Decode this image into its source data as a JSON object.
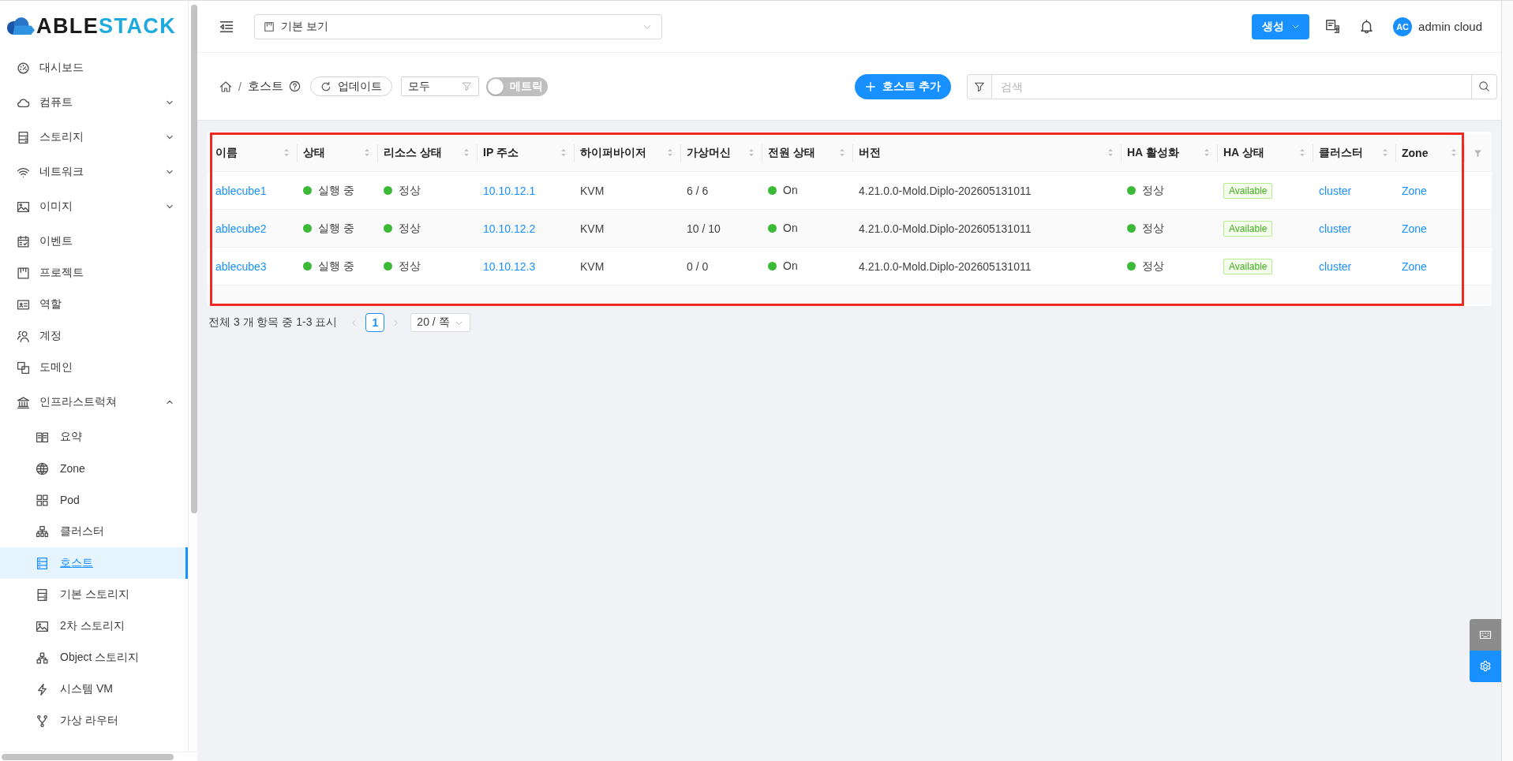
{
  "sidebar": {
    "logo": {
      "text": "ABLE",
      "accent_text": "STACK"
    },
    "items": [
      {
        "label": "대시보드",
        "kind": "item",
        "selected": false
      },
      {
        "label": "컴퓨트",
        "kind": "submenu",
        "expanded": false,
        "selected": false
      },
      {
        "label": "스토리지",
        "kind": "submenu",
        "expanded": false,
        "selected": false
      },
      {
        "label": "네트워크",
        "kind": "submenu",
        "expanded": false,
        "selected": false
      },
      {
        "label": "이미지",
        "kind": "submenu",
        "expanded": false,
        "selected": false
      },
      {
        "label": "이벤트",
        "kind": "item",
        "selected": false
      },
      {
        "label": "프로젝트",
        "kind": "item",
        "selected": false
      },
      {
        "label": "역할",
        "kind": "item",
        "selected": false
      },
      {
        "label": "계정",
        "kind": "item",
        "selected": false
      },
      {
        "label": "도메인",
        "kind": "item",
        "selected": false
      },
      {
        "label": "인프라스트럭쳐",
        "kind": "submenu",
        "expanded": true,
        "selected": false,
        "children": [
          {
            "label": "요약",
            "selected": false
          },
          {
            "label": "Zone",
            "selected": false
          },
          {
            "label": "Pod",
            "selected": false
          },
          {
            "label": "클러스터",
            "selected": false
          },
          {
            "label": "호스트",
            "selected": true
          },
          {
            "label": "기본 스토리지",
            "selected": false
          },
          {
            "label": "2차 스토리지",
            "selected": false
          },
          {
            "label": "Object 스토리지",
            "selected": false
          },
          {
            "label": "시스템 VM",
            "selected": false
          },
          {
            "label": "가상 라우터",
            "selected": false
          }
        ]
      }
    ]
  },
  "header": {
    "view_select": {
      "value": "기본 보기"
    },
    "create_button": {
      "label": "생성"
    },
    "user": {
      "initials": "AC",
      "name": "admin cloud"
    }
  },
  "toolbar": {
    "breadcrumb": {
      "separator": "/",
      "items": [
        "호스트"
      ]
    },
    "refresh_button": {
      "label": "업데이트"
    },
    "filter_select": {
      "value": "모두"
    },
    "metrics_toggle": {
      "label": "메트릭",
      "on": false
    },
    "add_button": {
      "label": "호스트 추가"
    },
    "search": {
      "placeholder": "검색"
    }
  },
  "table": {
    "highlighted": true,
    "columns": [
      {
        "label": "이름",
        "kind": "link"
      },
      {
        "label": "상태",
        "kind": "status"
      },
      {
        "label": "리소스 상태",
        "kind": "status"
      },
      {
        "label": "IP 주소",
        "kind": "link"
      },
      {
        "label": "하이퍼바이저",
        "kind": "text"
      },
      {
        "label": "가상머신",
        "kind": "text"
      },
      {
        "label": "전원 상태",
        "kind": "status"
      },
      {
        "label": "버전",
        "kind": "text"
      },
      {
        "label": "HA 활성화",
        "kind": "status"
      },
      {
        "label": "HA 상태",
        "kind": "tag"
      },
      {
        "label": "클러스터",
        "kind": "link"
      },
      {
        "label": "Zone",
        "kind": "link"
      }
    ],
    "rows": [
      {
        "cells": [
          "ablecube1",
          "실행 중",
          "정상",
          "10.10.12.1",
          "KVM",
          "6 / 6",
          "On",
          "4.21.0.0-Mold.Diplo-202605131011",
          "정상",
          "Available",
          "cluster",
          "Zone"
        ]
      },
      {
        "cells": [
          "ablecube2",
          "실행 중",
          "정상",
          "10.10.12.2",
          "KVM",
          "10 / 10",
          "On",
          "4.21.0.0-Mold.Diplo-202605131011",
          "정상",
          "Available",
          "cluster",
          "Zone"
        ]
      },
      {
        "cells": [
          "ablecube3",
          "실행 중",
          "정상",
          "10.10.12.3",
          "KVM",
          "0 / 0",
          "On",
          "4.21.0.0-Mold.Diplo-202605131011",
          "정상",
          "Available",
          "cluster",
          "Zone"
        ]
      }
    ]
  },
  "pagination": {
    "summary": "전체 3 개 항목 중 1-3 표시",
    "pages": [
      {
        "label": "1",
        "selected": true
      }
    ],
    "page_size": "20 / 쪽"
  }
}
